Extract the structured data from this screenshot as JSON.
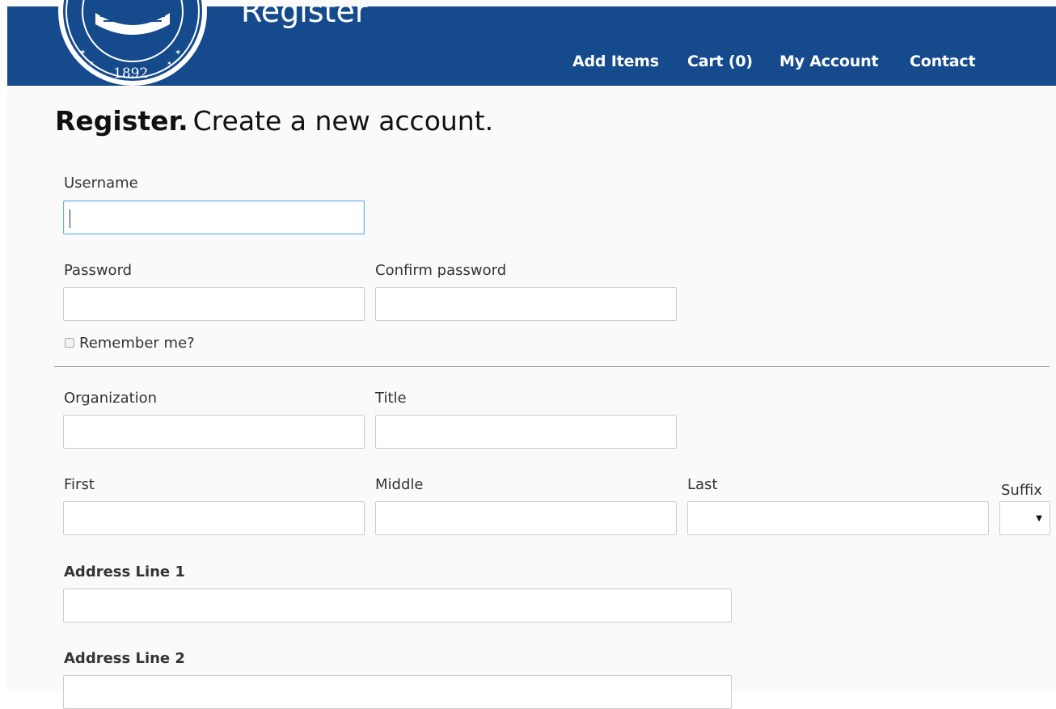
{
  "header": {
    "site_title": "Register",
    "seal_year": "1892",
    "nav": [
      "Add Items",
      "Cart (0)",
      "My Account",
      "Contact"
    ]
  },
  "heading": {
    "strong": "Register.",
    "sub": "Create a new account."
  },
  "form": {
    "username_label": "Username",
    "username_value": "",
    "password_label": "Password",
    "confirm_password_label": "Confirm password",
    "remember_label": "Remember me?",
    "remember_checked": false,
    "organization_label": "Organization",
    "title_label": "Title",
    "first_label": "First",
    "middle_label": "Middle",
    "last_label": "Last",
    "suffix_label": "Suffix",
    "suffix_selected": "",
    "address1_label": "Address Line 1",
    "address2_label": "Address Line 2"
  },
  "colors": {
    "header_bg": "#154a8c",
    "focus_border": "#66afe9"
  },
  "icons": [
    "city-seal-logo",
    "dropdown-arrow-icon"
  ]
}
